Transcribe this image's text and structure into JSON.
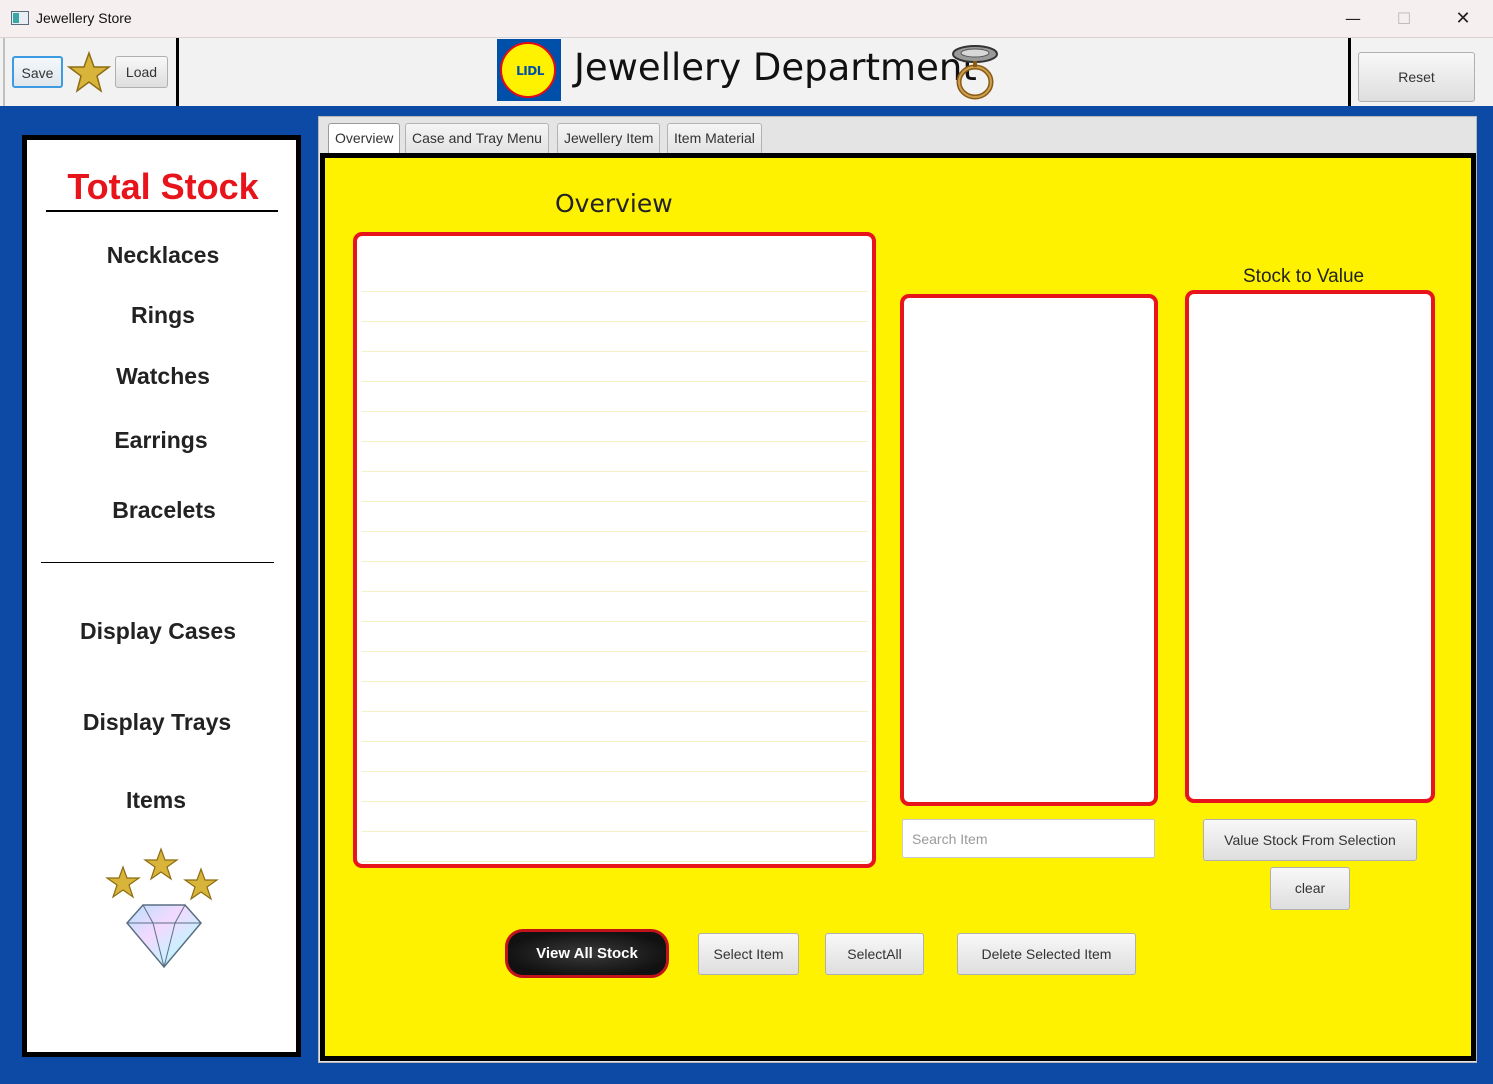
{
  "window": {
    "title": "Jewellery Store",
    "controls": {
      "minimize": "—",
      "maximize": "☐",
      "close": "✕"
    }
  },
  "header": {
    "save_label": "Save",
    "load_label": "Load",
    "reset_label": "Reset",
    "logo_text": "LIDL",
    "title": "Jewellery Department",
    "brand_colors": {
      "blue": "#0050aa",
      "yellow": "#fff200",
      "red": "#e60a14"
    }
  },
  "sidebar": {
    "title": "Total Stock",
    "categories": [
      "Necklaces",
      "Rings",
      "Watches",
      "Earrings",
      "Bracelets"
    ],
    "sections": [
      "Display Cases",
      "Display Trays",
      "Items"
    ]
  },
  "tabs": [
    "Overview",
    "Case and Tray Menu",
    "Jewellery Item",
    "Item Material"
  ],
  "overview": {
    "heading": "Overview",
    "stock_to_value_label": "Stock to Value",
    "search_placeholder": "Search Item",
    "value_stock_button": "Value Stock From Selection",
    "clear_button": "clear",
    "view_all_stock_button": "View All Stock",
    "select_item_button": "Select Item",
    "select_all_button": "SelectAll",
    "delete_selected_button": "Delete Selected Item"
  },
  "colors": {
    "window_bg": "#0d4aa6",
    "content_bg": "#fff200",
    "list_border": "#e8141c",
    "sidebar_title": "#e8141c"
  },
  "icons": [
    "app-icon",
    "star-icon",
    "ring-icon",
    "stars-icon",
    "diamond-icon"
  ]
}
